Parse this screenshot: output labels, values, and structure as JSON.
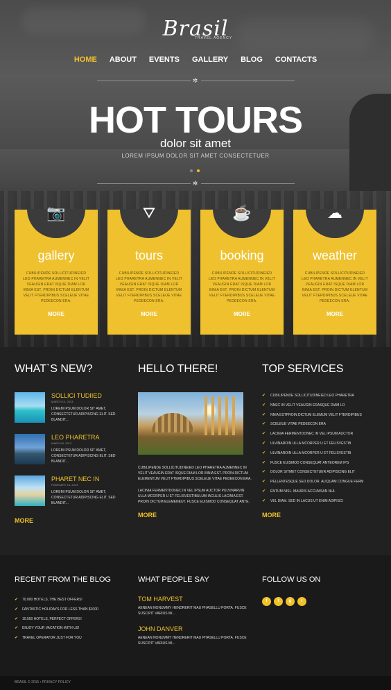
{
  "brand": {
    "logo": "Brasil",
    "tagline": "TRAVEL AGENCY"
  },
  "nav": [
    {
      "label": "HOME",
      "active": true
    },
    {
      "label": "ABOUT"
    },
    {
      "label": "EVENTS"
    },
    {
      "label": "GALLERY"
    },
    {
      "label": "BLOG"
    },
    {
      "label": "CONTACTS"
    }
  ],
  "hero": {
    "title": "HOT TOURS",
    "subtitle": "dolor sit amet",
    "small": "LOREM IPSUM DOLOR SIT AMET CONSECTETUER"
  },
  "cards": [
    {
      "icon": "camera-icon",
      "glyph": "📷",
      "title": "gallery",
      "text": "CUBILIPENDE SOLLICITUDINEIED LEO PHARETRA AUMENNEC IN VELIT VEAUGIN ERAT ISQUE DIAM LOR INNIA EST. PROIN DICTUM ELENTUM VELIT FTERDIPIBUS SCELEUE VITAE PEDEECON ERA.",
      "more": "MORE"
    },
    {
      "icon": "road-icon",
      "glyph": "⛛",
      "title": "tours",
      "text": "CUBILIPENDE SOLLICITUDINEIED LEO PHARETRA AUMENNEC IN VELIT VEAUGIN ERAT ISQUE DIAM LOR INNIA EST. PROIN DICTUM ELENTUM VELIT FTERDIPIBUS SCELEUE VITAE PEDEECON ERA.",
      "more": "MORE"
    },
    {
      "icon": "cup-icon",
      "glyph": "☕",
      "title": "booking",
      "text": "CUBILIPENDE SOLLICITUDINEIED LEO PHARETRA AUMENNEC IN VELIT VEAUGIN ERAT ISQUE DIAM LOR INNIA EST. PROIN DICTUM ELENTUM VELIT FTERDIPIBUS SCELEUE VITAE PEDEECON ERA.",
      "more": "MORE"
    },
    {
      "icon": "cloud-icon",
      "glyph": "☁",
      "title": "weather",
      "text": "CUBILIPENDE SOLLICITUDINEIED LEO PHARETRA AUMENNEC IN VELIT VEAUGIN ERAT ISQUE DIAM LOR INNIA EST. PROIN DICTUM ELENTUM VELIT FTERDIPIBUS SCELEUE VITAE PEDEECON ERA.",
      "more": "MORE"
    }
  ],
  "whats_new": {
    "heading": "WHAT`S NEW?",
    "items": [
      {
        "title": "SOLLICI TUDIIED",
        "date": "MARCH 14, 2013",
        "text": "LOREM IPSUM DOLOR SIT AMET, CONSECTETUR ADIPISCING ELIT. SED BLANDIT..."
      },
      {
        "title": "LEO PHARETRA",
        "date": "MARCH 5, 2013",
        "text": "LOREM IPSUM DOLOR SIT AMET, CONSECTETUR ADIPISCING ELIT. SED BLANDIT..."
      },
      {
        "title": "PHARET NEC IN",
        "date": "FEBRUARY 14, 2013",
        "text": "LOREM IPSUM DOLOR SIT AMET, CONSECTETUR ADIPISCING ELIT. SED BLANDIT..."
      }
    ],
    "more": "MORE"
  },
  "hello": {
    "heading": "HELLO THERE!",
    "para1": "CUBILIPENDE SOLLICITUDINEIED LEO PHARETRA AUMENNEC IN VELIT VEAUGIN ERAT ISQUE DIAM LOR INNIA EST. PROIN DICTUM ELEMENTUM VELIT FTERDIPIBUS SCELEUE VITAE PEDEECON ERA.",
    "para2": "LACINIA FERMENTDONEC IN VEL IPSUM AUCTOR PULVINARVIN ULLA MCORPER U ET FELISVESTIBULUM IACULIS LACINIA EST. PROIN DICTUM ELEMENEUT. FUSCE EUISMOD CONSEQUAT ANTE.",
    "more": "MORE"
  },
  "services": {
    "heading": "TOP SERVICES",
    "items": [
      "CUBILIPENDE SOLLICITUDINEIED LEO PHARETRA",
      "NNEC IN VELIT VEAUGIN ERASQUE DIAM LO",
      "NNIA ESTPROIN DICTUM ELEMUM VELIT FTERDIPIBUS",
      "SCELEUE VITAE PEDEECON ERA",
      "LACINIA FERMENTDONEC IN VEL IPSUM AUCTOR",
      "ULVINAROIN ULLA MCORPER U ET FELISVESTIB",
      "ULVINAROIN ULLA MCORPER U ET FELISVESTIB",
      "FUSCE EUISMOD CONSEQUAT ANTEOREM IPS",
      "DOLOR SITMET CONSECTETUER ADIPISCING ELIT",
      "PELLENTESQUE SED DOLOR. ALIQUAM CONGUE FERM",
      "ENTUM NISL. MAURIS ACCUMSAN NUL",
      "VEL DIAM. SED IN LACUS UT ENIM ADIPISCI"
    ],
    "more": "MORE"
  },
  "footer": {
    "blog_heading": "RECENT FROM THE BLOG",
    "blog_items": [
      "70.000 HOTELS, THE BEST OFFERS!",
      "FANTASTIC HOLIDAYS FOR LESS THAN $1000",
      "10.500 HOTELS, PERFECT OFFERS!",
      "ENJOY YOUR VACATION WITH US!",
      "TRAVEL OPERATOR JUST FOR YOU"
    ],
    "people_heading": "WHAT PEOPLE SAY",
    "testimonials": [
      {
        "name": "TOM HARVEST",
        "text": "AENEAN NONUMMY HENDRERIT MAU PHASELLU PORTA. FUSCE SUSCIPIT VARIUS MI..."
      },
      {
        "name": "JOHN DANVER",
        "text": "AENEAN NONUMMY HENDRERIT MAU PHASELLU PORTA. FUSCE SUSCIPIT VARIUS MI..."
      }
    ],
    "follow_heading": "FOLLOW US ON",
    "socials": [
      {
        "name": "facebook-icon",
        "glyph": "f"
      },
      {
        "name": "twitter-icon",
        "glyph": "t"
      },
      {
        "name": "google-plus-icon",
        "glyph": "g"
      },
      {
        "name": "rss-icon",
        "glyph": "r"
      }
    ],
    "copyright": "BRASIL © 2015 • PRIVACY POLICY"
  },
  "colors": {
    "accent": "#f0c12a",
    "card": "#efc12f",
    "bg": "#212121"
  }
}
